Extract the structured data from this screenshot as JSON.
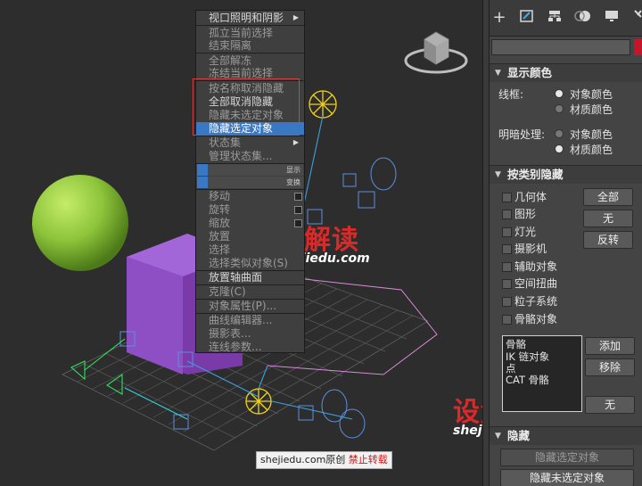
{
  "context_menu": {
    "items": [
      {
        "label": "视口照明和阴影",
        "dim": false,
        "has_sub": true
      },
      {
        "label": "孤立当前选择",
        "dim": true
      },
      {
        "label": "结束隔离",
        "dim": true
      },
      {
        "label": "全部解冻",
        "dim": true
      },
      {
        "label": "冻结当前选择",
        "dim": true
      },
      {
        "label": "按名称取消隐藏",
        "dim": true
      },
      {
        "label": "全部取消隐藏",
        "dim": false
      },
      {
        "label": "隐藏未选定对象",
        "dim": true
      },
      {
        "label": "隐藏选定对象",
        "dim": false,
        "highlighted": true
      },
      {
        "label": "状态集",
        "dim": true,
        "has_sub": true
      },
      {
        "label": "管理状态集...",
        "dim": true
      }
    ],
    "quad_labels": {
      "display": "显示",
      "transform": "变换"
    },
    "transform_items": [
      {
        "label": "移动",
        "dim": true
      },
      {
        "label": "旋转",
        "dim": true
      },
      {
        "label": "缩放",
        "dim": true
      },
      {
        "label": "放置",
        "dim": true
      },
      {
        "label": "选择",
        "dim": true
      },
      {
        "label": "选择类似对象(S)",
        "dim": true
      },
      {
        "label": "放置轴曲面",
        "dim": false
      },
      {
        "label": "克隆(C)",
        "dim": true
      },
      {
        "label": "对象属性(P)...",
        "dim": true
      },
      {
        "label": "曲线编辑器...",
        "dim": true
      },
      {
        "label": "摄影表...",
        "dim": true
      },
      {
        "label": "连线参数...",
        "dim": true
      }
    ]
  },
  "watermark": {
    "logo_text": "设解读",
    "url": "shejiedu.com",
    "credit_prefix": "shejiedu.com原创",
    "credit_warning": "禁止转载"
  },
  "panel": {
    "toolbar_icons": [
      "create-icon",
      "modify-icon",
      "hierarchy-icon",
      "motion-icon",
      "display-icon",
      "utilities-icon"
    ],
    "display_color": {
      "title": "显示颜色",
      "wireframe_label": "线框:",
      "shaded_label": "明暗处理:",
      "option_object_color": "对象颜色",
      "option_material_color": "材质颜色",
      "wireframe_selected": "object",
      "shaded_selected": "material"
    },
    "hide_by_category": {
      "title": "按类别隐藏",
      "categories": [
        "几何体",
        "图形",
        "灯光",
        "摄影机",
        "辅助对象",
        "空间扭曲",
        "粒子系统",
        "骨骼对象"
      ],
      "btn_all": "全部",
      "btn_none": "无",
      "btn_invert": "反转",
      "list_items": [
        "骨骼",
        "IK 链对象",
        "点",
        "CAT 骨骼"
      ],
      "btn_add": "添加",
      "btn_remove": "移除",
      "btn_none2": "无"
    },
    "hide": {
      "title": "隐藏",
      "btn_hide_selected": "隐藏选定对象",
      "btn_hide_unselected": "隐藏未选定对象"
    }
  },
  "colors": {
    "accent": "#3b78c4",
    "highlight_box": "#d24242",
    "sphere": "#8cc43a",
    "box": "#8e4fc4"
  }
}
